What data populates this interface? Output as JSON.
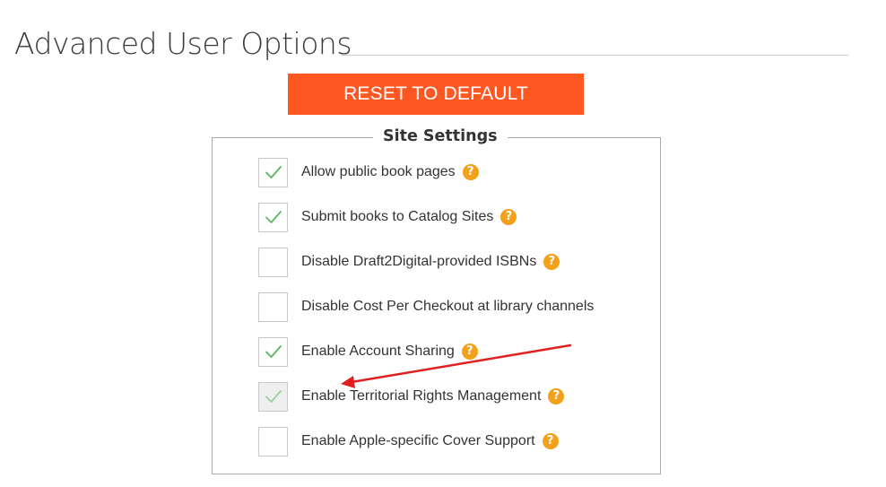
{
  "page": {
    "title": "Advanced User Options"
  },
  "reset_button": {
    "label": "RESET TO DEFAULT",
    "color": "#ff5722"
  },
  "site_settings": {
    "legend": "Site Settings",
    "help_icon_glyph": "?",
    "help_icon_color": "#f5a01a",
    "check_color": "#5cb85c",
    "options": [
      {
        "label": "Allow public book pages",
        "checked": true,
        "disabled": false,
        "has_help": true
      },
      {
        "label": "Submit books to Catalog Sites",
        "checked": true,
        "disabled": false,
        "has_help": true
      },
      {
        "label": "Disable Draft2Digital-provided ISBNs",
        "checked": false,
        "disabled": false,
        "has_help": true
      },
      {
        "label": "Disable Cost Per Checkout at library channels",
        "checked": false,
        "disabled": false,
        "has_help": false
      },
      {
        "label": "Enable Account Sharing",
        "checked": true,
        "disabled": false,
        "has_help": true
      },
      {
        "label": "Enable Territorial Rights Management",
        "checked": true,
        "disabled": true,
        "has_help": true
      },
      {
        "label": "Enable Apple-specific Cover Support",
        "checked": false,
        "disabled": false,
        "has_help": true
      }
    ]
  },
  "annotation": {
    "color": "#e02020",
    "icon": "red-arrow-pointing-at-territorial-rights-option"
  }
}
